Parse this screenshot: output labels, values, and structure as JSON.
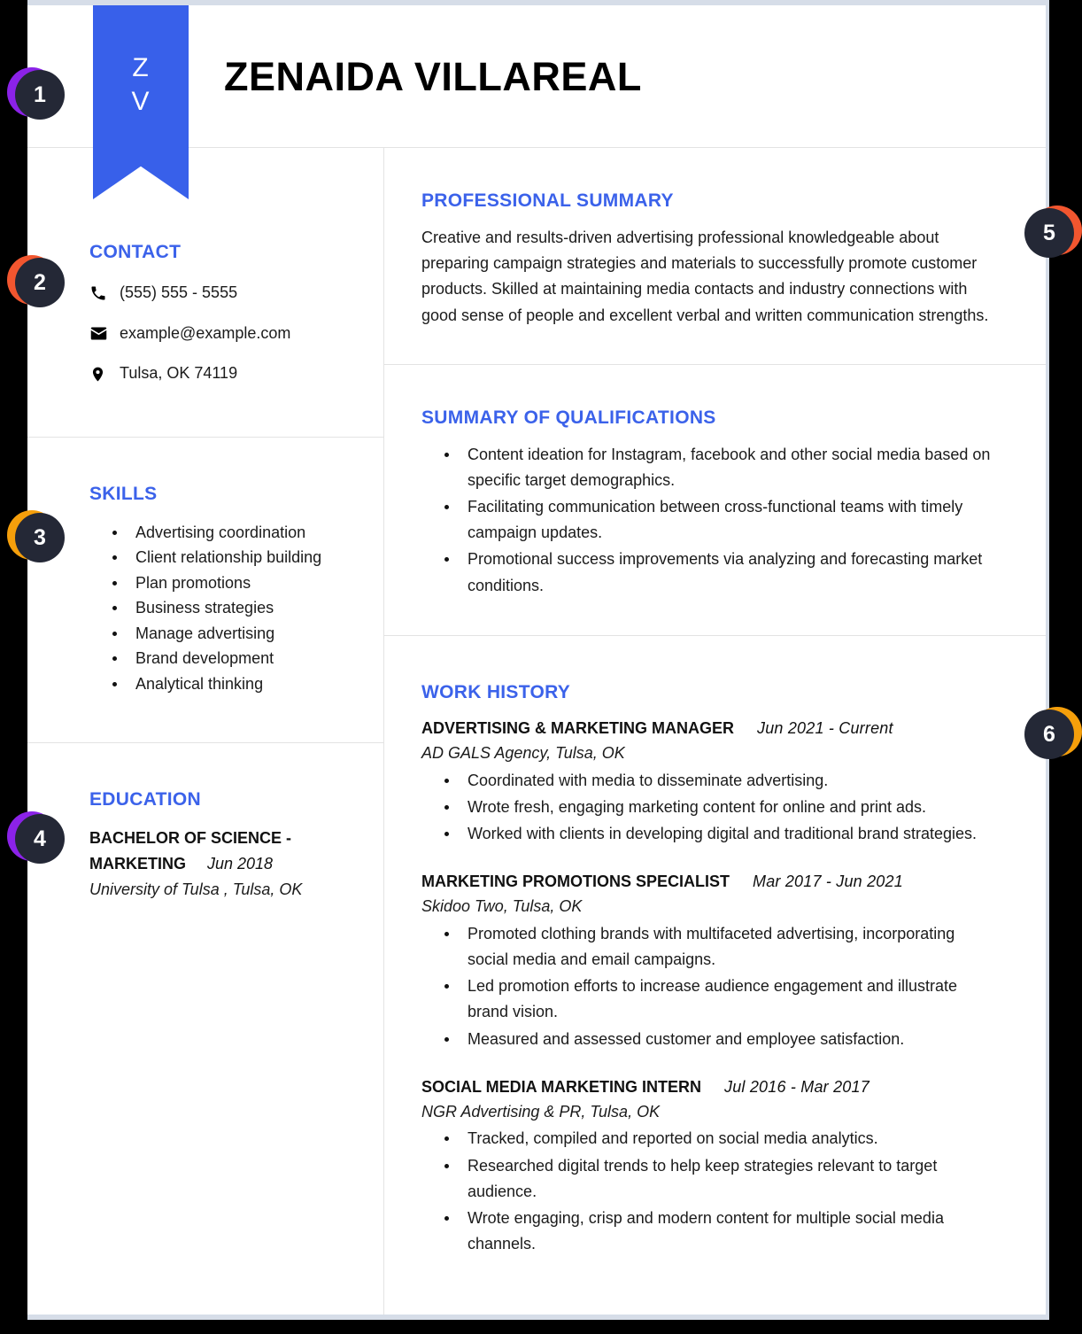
{
  "document": {
    "type": "resume",
    "accent_color": "#3b62ea",
    "ribbon_color": "#3860ea",
    "text_color": "#1b1b1b"
  },
  "header": {
    "full_name": "ZENAIDA VILLAREAL",
    "monogram_line1": "Z",
    "monogram_line2": "V"
  },
  "sidebar": {
    "contact": {
      "title": "CONTACT",
      "items": [
        {
          "icon": "phone-icon",
          "value": "(555) 555 - 5555"
        },
        {
          "icon": "envelope-icon",
          "value": "example@example.com"
        },
        {
          "icon": "location-pin-icon",
          "value": "Tulsa, OK 74119"
        }
      ]
    },
    "skills": {
      "title": "SKILLS",
      "items": [
        "Advertising coordination",
        "Client relationship building",
        "Plan promotions",
        "Business strategies",
        "Manage advertising",
        "Brand development",
        "Analytical thinking"
      ]
    },
    "education": {
      "title": "EDUCATION",
      "degree_line1": "BACHELOR OF SCIENCE -",
      "degree_line2": "MARKETING",
      "date": "Jun 2018",
      "school": "University of Tulsa , Tulsa, OK"
    }
  },
  "main": {
    "professional_summary": {
      "title": "PROFESSIONAL SUMMARY",
      "text": "Creative and results-driven advertising professional knowledgeable about preparing campaign strategies and materials to successfully promote customer products. Skilled at maintaining media contacts and industry connections with good sense of people and excellent verbal and written communication strengths."
    },
    "summary_of_qualifications": {
      "title": "SUMMARY OF QUALIFICATIONS",
      "items": [
        "Content ideation for Instagram, facebook and other social media based on specific target demographics.",
        "Facilitating communication between cross-functional teams with timely campaign updates.",
        "Promotional success improvements via analyzing and forecasting market conditions."
      ]
    },
    "work_history": {
      "title": "WORK HISTORY",
      "jobs": [
        {
          "title": "ADVERTISING & MARKETING MANAGER",
          "dates": "Jun 2021 - Current",
          "company": "AD GALS Agency, Tulsa, OK",
          "bullets": [
            "Coordinated with media to disseminate advertising.",
            "Wrote fresh, engaging marketing content for online and print ads.",
            "Worked with clients in developing digital and traditional brand strategies."
          ]
        },
        {
          "title": "MARKETING PROMOTIONS SPECIALIST",
          "dates": "Mar 2017 - Jun 2021",
          "company": "Skidoo Two, Tulsa, OK",
          "bullets": [
            "Promoted clothing brands with multifaceted advertising, incorporating social media and email campaigns.",
            "Led promotion efforts to increase audience engagement and illustrate brand vision.",
            "Measured and assessed customer and employee satisfaction."
          ]
        },
        {
          "title": "SOCIAL MEDIA MARKETING INTERN",
          "dates": "Jul 2016 - Mar 2017",
          "company": "NGR Advertising & PR, Tulsa, OK",
          "bullets": [
            "Tracked, compiled and reported on social media analytics.",
            "Researched digital trends to help keep strategies relevant to target audience.",
            "Wrote engaging, crisp and modern content for multiple social media channels."
          ]
        }
      ]
    }
  },
  "callouts": [
    {
      "number": "1",
      "ring_color": "#8b22e8"
    },
    {
      "number": "2",
      "ring_color": "#f2562f"
    },
    {
      "number": "3",
      "ring_color": "#f59f0b"
    },
    {
      "number": "4",
      "ring_color": "#8b22e8"
    },
    {
      "number": "5",
      "ring_color": "#f2562f"
    },
    {
      "number": "6",
      "ring_color": "#f59f0b"
    }
  ]
}
